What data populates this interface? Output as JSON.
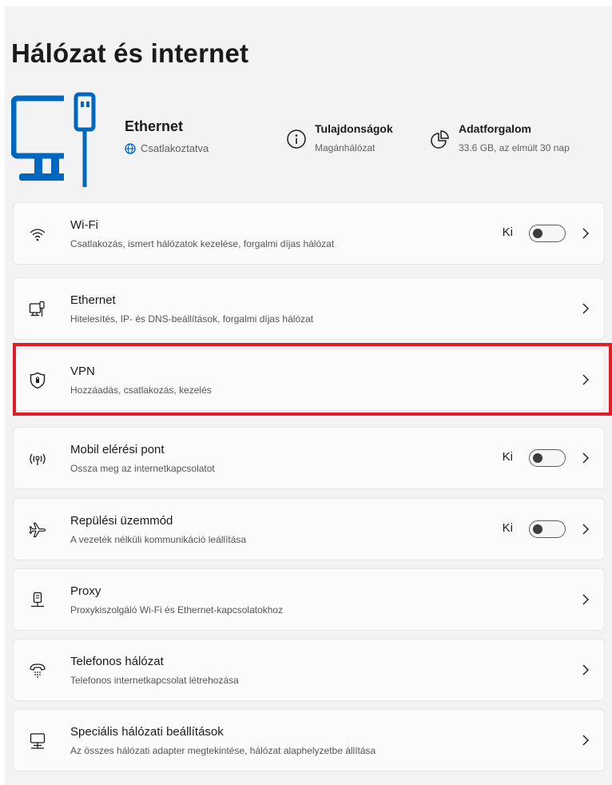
{
  "page": {
    "title": "Hálózat és internet"
  },
  "hero": {
    "device_name": "Ethernet",
    "device_status": "Csatlakoztatva",
    "properties": {
      "title": "Tulajdonságok",
      "subtitle": "Magánhálózat"
    },
    "traffic": {
      "title": "Adatforgalom",
      "subtitle": "33.6 GB, az elmúlt 30 nap"
    }
  },
  "colors": {
    "accent": "#0067c0",
    "highlight": "#e01e2a"
  },
  "settings": [
    {
      "icon": "wifi-icon",
      "title": "Wi-Fi",
      "subtitle": "Csatlakozás, ismert hálózatok kezelése, forgalmi díjas hálózat",
      "toggle_label": "Ki",
      "toggle_on": false
    },
    {
      "icon": "ethernet-icon",
      "title": "Ethernet",
      "subtitle": "Hitelesítés, IP- és DNS-beállítások, forgalmi díjas hálózat"
    },
    {
      "icon": "shield-icon",
      "title": "VPN",
      "subtitle": "Hozzáadás, csatlakozás, kezelés",
      "highlighted": true
    },
    {
      "icon": "hotspot-icon",
      "title": "Mobil elérési pont",
      "subtitle": "Ossza meg az internetkapcsolatot",
      "toggle_label": "Ki",
      "toggle_on": false
    },
    {
      "icon": "airplane-icon",
      "title": "Repülési üzemmód",
      "subtitle": "A vezeték nélküli kommunikáció leállítása",
      "toggle_label": "Ki",
      "toggle_on": false
    },
    {
      "icon": "proxy-icon",
      "title": "Proxy",
      "subtitle": "Proxykiszolgáló Wi-Fi és Ethernet-kapcsolatokhoz"
    },
    {
      "icon": "dialup-icon",
      "title": "Telefonos hálózat",
      "subtitle": "Telefonos internetkapcsolat létrehozása"
    },
    {
      "icon": "advanced-network-icon",
      "title": "Speciális hálózati beállítások",
      "subtitle": "Az összes hálózati adapter megtekintése, hálózat alaphelyzetbe állítása"
    }
  ]
}
